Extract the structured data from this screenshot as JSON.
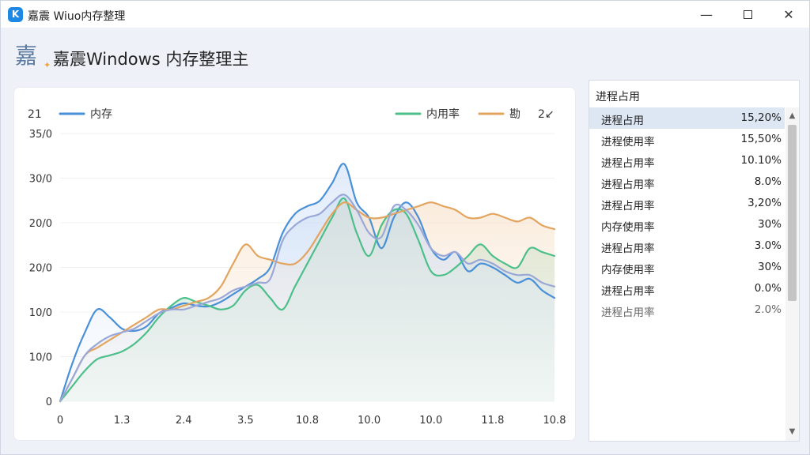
{
  "window": {
    "title": "嘉震 Wiuo内存整理",
    "controls": {
      "minimize": "—",
      "close": "✕"
    }
  },
  "header": {
    "logo_text": "嘉",
    "logo_spark": "✦",
    "app_title": "嘉震Windows 内存整理主"
  },
  "chart_data": {
    "type": "area",
    "corner_label": "21",
    "legend": [
      {
        "name": "内存",
        "color": "#4a90d9"
      },
      {
        "name": "内用率",
        "color": "#4cbf8a"
      },
      {
        "name": "勘",
        "color": "#e3a45f"
      }
    ],
    "legend_right_text": "2↙",
    "y_ticks": [
      "0",
      "10/0",
      "10/0",
      "20/0",
      "20/0",
      "30/0",
      "35/0"
    ],
    "x_ticks": [
      "0",
      "1.3",
      "2.4",
      "3.5",
      "10.8",
      "10.0",
      "10.0",
      "11.8",
      "10.8"
    ],
    "ylim": [
      0,
      35
    ],
    "x_index": [
      0,
      0.5,
      1,
      1.5,
      2,
      2.5,
      3,
      3.5,
      4,
      4.5,
      5,
      5.5,
      6,
      6.5,
      7,
      7.5,
      8,
      8.5,
      9,
      9.5,
      10,
      10.5,
      11,
      11.5,
      12,
      12.5,
      13,
      13.5,
      14,
      14.5,
      15,
      15.5,
      16,
      16.5,
      17,
      17.5,
      18,
      18.5,
      19,
      19.5,
      20
    ],
    "series": [
      {
        "name": "内存",
        "color": "#4a90d9",
        "values": [
          0,
          5,
          9,
          12,
          11,
          9.5,
          9.2,
          9.8,
          11.5,
          12.2,
          12.8,
          12.5,
          12.4,
          13,
          14,
          15,
          16,
          17.5,
          22,
          24.5,
          25.5,
          26.2,
          28.5,
          31,
          26,
          24,
          20,
          24,
          26,
          24,
          20,
          18.5,
          19.5,
          17,
          18,
          17.5,
          16.5,
          15.5,
          16,
          14.5,
          13.5
        ]
      },
      {
        "name": "内用率",
        "color": "#4cbf8a",
        "values": [
          0,
          2,
          4,
          5.5,
          6,
          6.5,
          7.5,
          9,
          11,
          12.5,
          13.5,
          13,
          12.5,
          12,
          12.5,
          14.5,
          15.2,
          13.5,
          12,
          15,
          18,
          21,
          24,
          26.5,
          22,
          19,
          23,
          25,
          24.5,
          21,
          17,
          16.5,
          17.5,
          19,
          20.5,
          19,
          18,
          17.5,
          20,
          19.5,
          19
        ]
      },
      {
        "name": "勘",
        "color": "#e3a45f",
        "values": [
          0,
          3,
          6,
          7,
          8,
          9,
          10,
          11,
          12,
          12,
          12.5,
          13,
          13.5,
          15,
          18,
          20.5,
          19,
          18.5,
          18,
          18,
          19.5,
          22,
          24.5,
          26,
          25,
          24,
          24,
          24.5,
          25,
          25.5,
          26,
          25.5,
          25,
          24,
          24,
          24.5,
          24,
          23.5,
          24,
          23,
          22.5
        ]
      },
      {
        "name": "",
        "color": "#9aa8d8",
        "values": [
          0,
          3,
          6,
          7.5,
          8.5,
          9,
          9.5,
          10.5,
          11.5,
          12,
          12,
          12.5,
          13,
          13.5,
          14.5,
          15,
          15.5,
          16,
          21,
          23,
          24,
          24.5,
          26,
          27,
          25,
          22,
          21.5,
          25.5,
          25,
          23,
          20,
          19,
          19.5,
          18,
          18.5,
          18,
          17,
          16.5,
          16.5,
          15.5,
          15
        ]
      }
    ]
  },
  "process_panel": {
    "title": "进程占用",
    "items": [
      {
        "name": "进程占用",
        "value": "15,20%"
      },
      {
        "name": "进程使用率",
        "value": "15,50%"
      },
      {
        "name": "进程占用率",
        "value": "10.10%"
      },
      {
        "name": "进程占用率",
        "value": "8.0%"
      },
      {
        "name": "进程占用率",
        "value": "3,20%"
      },
      {
        "name": "内存使用率",
        "value": "30%"
      },
      {
        "name": "进程占用率",
        "value": "3.0%"
      },
      {
        "name": "内存使用率",
        "value": "30%"
      },
      {
        "name": "进程占用率",
        "value": "0.0%"
      },
      {
        "name": "进程占用率",
        "value": "2.0%"
      }
    ],
    "scroll_up": "▲",
    "scroll_down": "▼"
  },
  "colors": {
    "accent": "#1e88e5",
    "selected_row": "#dde7f4",
    "window_bg": "#eef2f8"
  }
}
